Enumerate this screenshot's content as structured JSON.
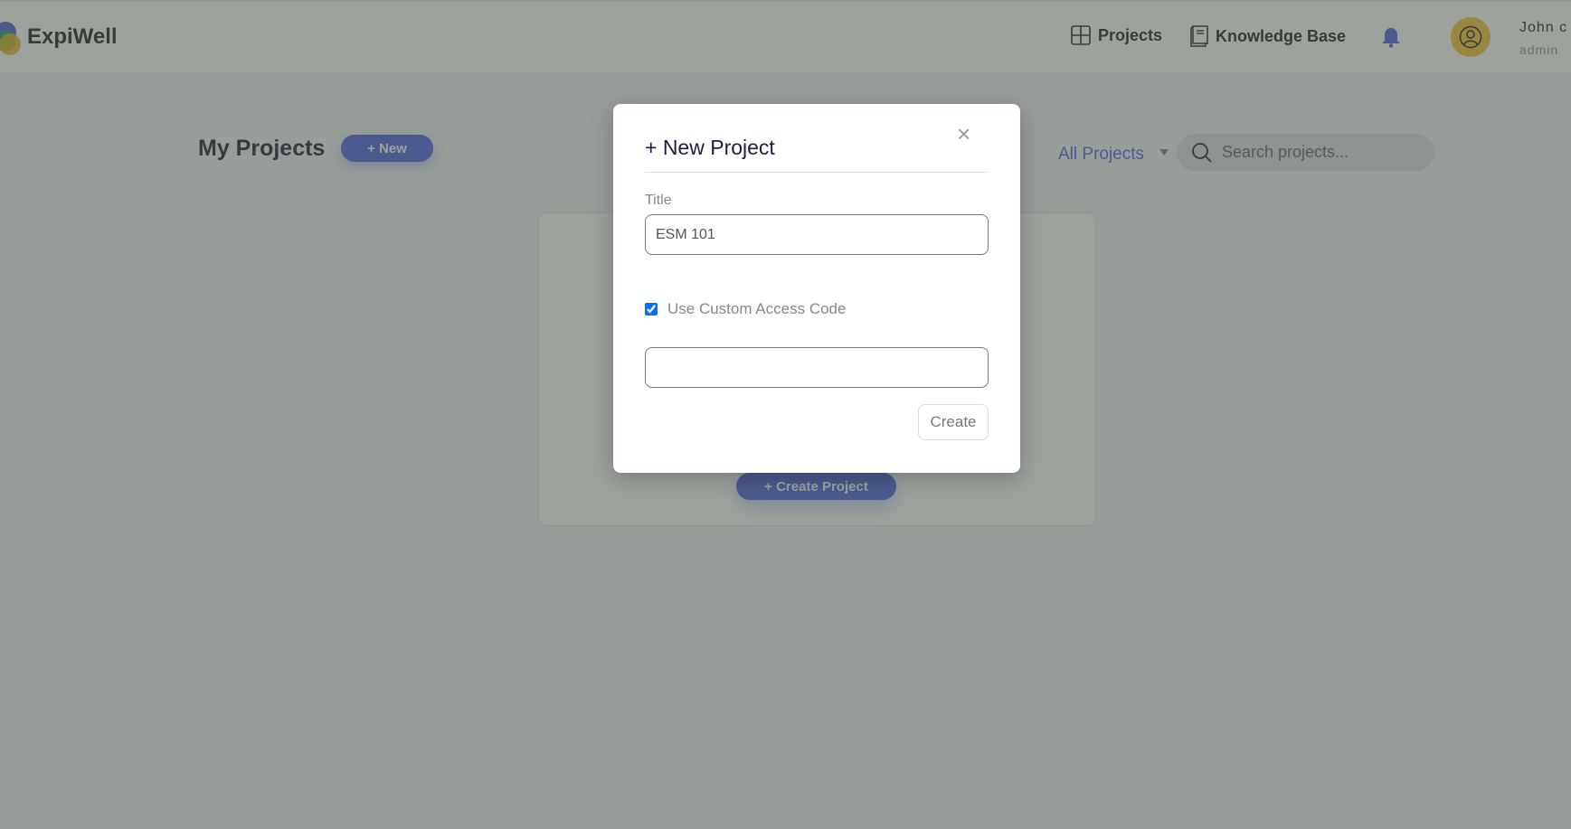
{
  "header": {
    "brand": "ExpiWell",
    "nav": [
      {
        "label": "Projects",
        "icon": "grid-icon"
      },
      {
        "label": "Knowledge Base",
        "icon": "book-icon"
      }
    ],
    "notifications_icon": "bell-icon",
    "user": {
      "name": "John c",
      "role": "admin",
      "avatar_icon": "user-circle-icon"
    }
  },
  "main": {
    "title": "My Projects",
    "new_button": "+ New",
    "filter": {
      "selected": "All Projects"
    },
    "search": {
      "placeholder": "Search projects...",
      "value": ""
    },
    "create_project_button": "+ Create Project"
  },
  "modal": {
    "title": "+ New Project",
    "close_label": "×",
    "title_label": "Title",
    "title_value": "ESM 101",
    "custom_code_label": "Use Custom Access Code",
    "custom_code_checked": true,
    "custom_code_value": "",
    "create_button": "Create"
  },
  "colors": {
    "accent": "#5b6ee1",
    "avatar": "#f5c842",
    "modal_title": "#1f1d45"
  }
}
